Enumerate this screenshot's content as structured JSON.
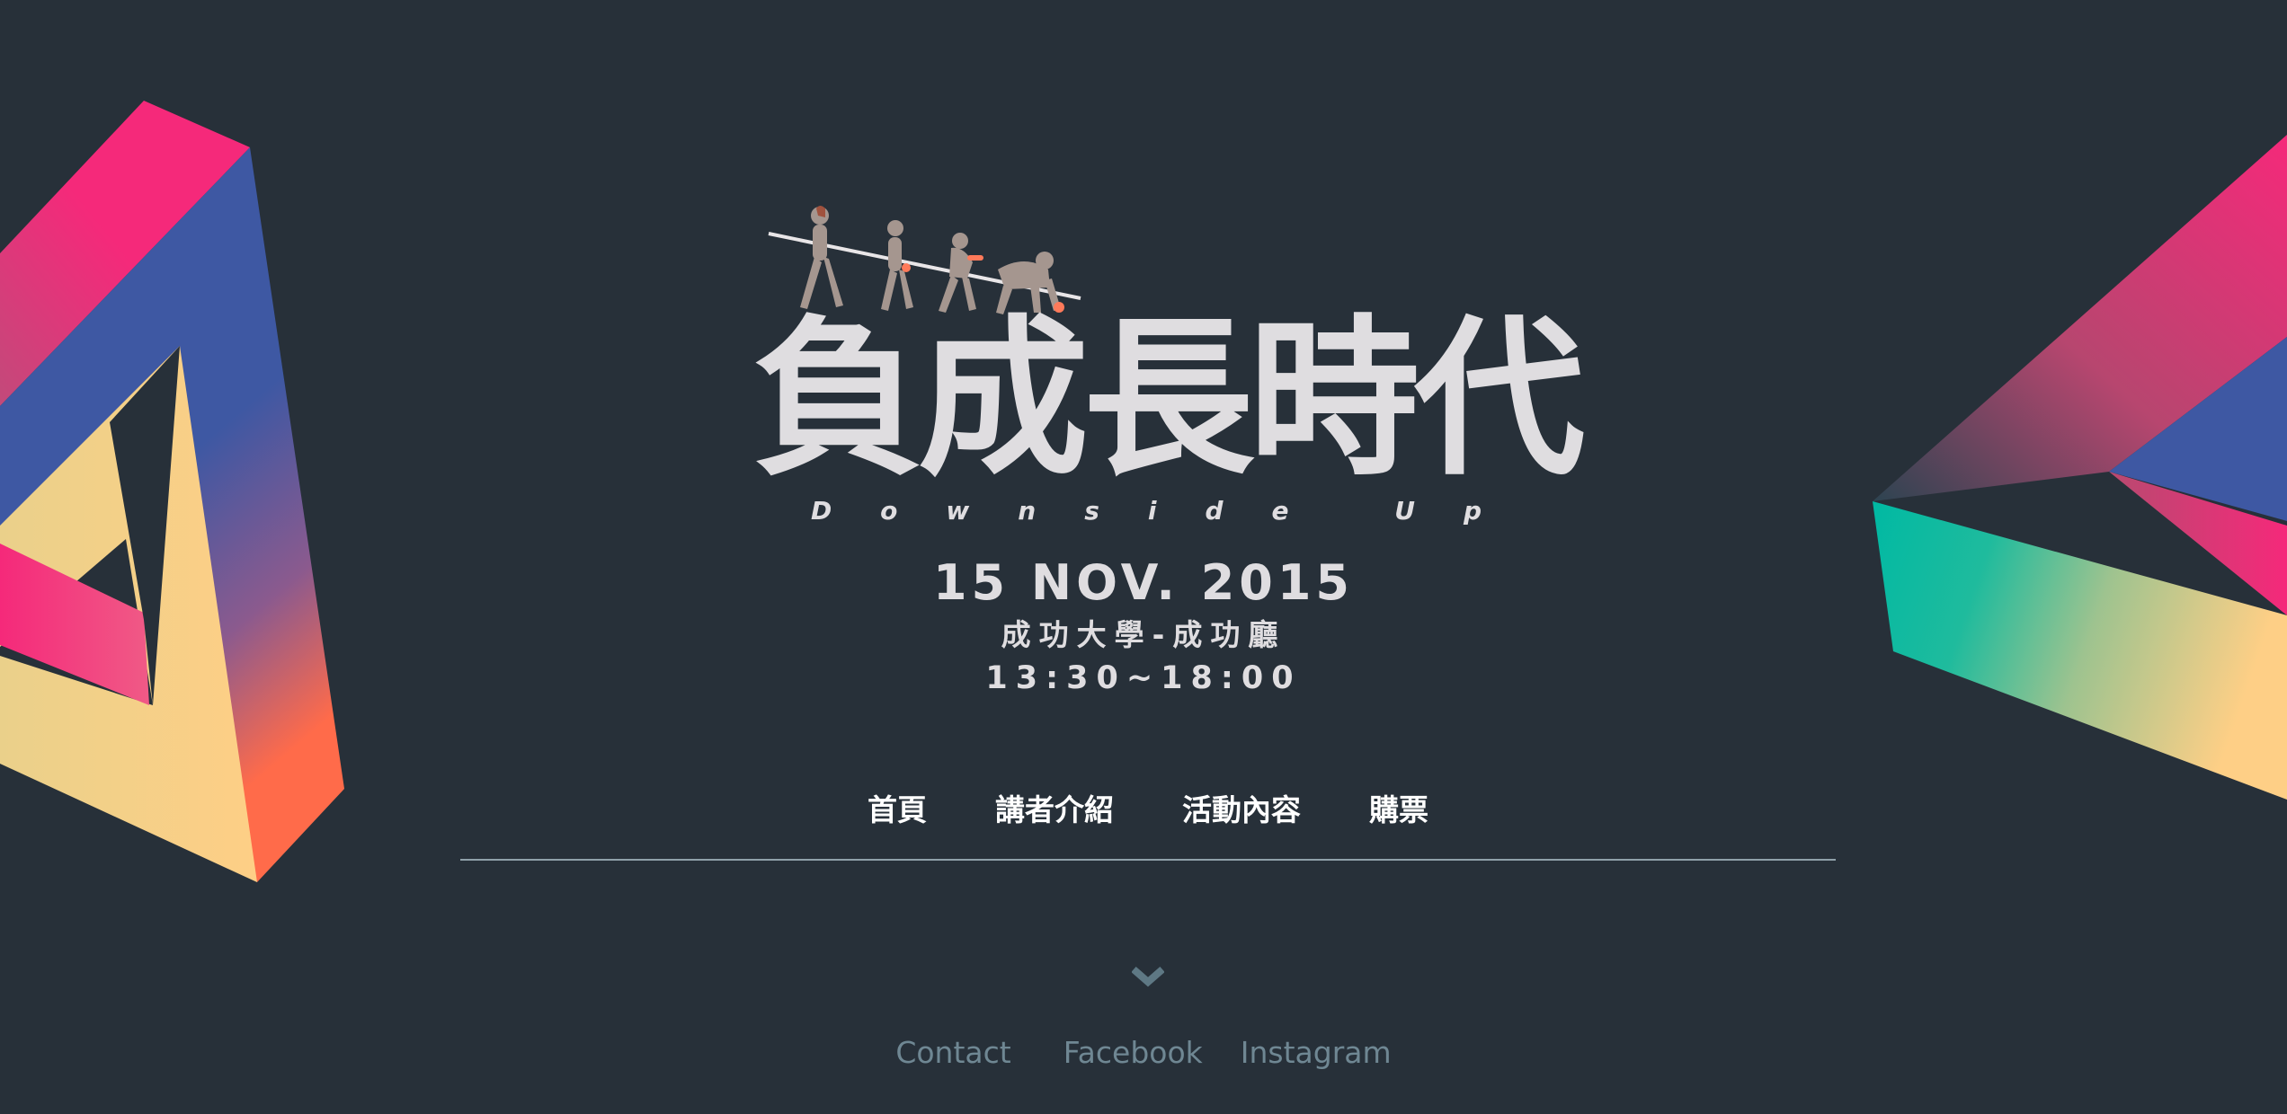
{
  "event": {
    "title": "負成長時代",
    "subtitle": "Downside Up",
    "date": "15 NOV. 2015",
    "venue": "成功大學-成功廳",
    "time": "13:30~18:00"
  },
  "nav": {
    "items": [
      {
        "label": "首頁"
      },
      {
        "label": "講者介紹"
      },
      {
        "label": "活動內容"
      },
      {
        "label": "購票"
      }
    ]
  },
  "scroll": {
    "icon": "chevron-down-icon"
  },
  "footer": {
    "links": [
      {
        "label": "Contact"
      },
      {
        "label": "Facebook"
      },
      {
        "label": "Instagram"
      }
    ]
  },
  "colors": {
    "background": "#273039",
    "title_text": "#dfdde0",
    "nav_text": "#ffffff",
    "footer_text": "#6f8793",
    "accent_pink": "#f5297a",
    "accent_blue": "#3e58a3",
    "accent_yellow": "#fecf86",
    "accent_orange": "#ff6b4a",
    "accent_teal": "#00b9a3"
  }
}
